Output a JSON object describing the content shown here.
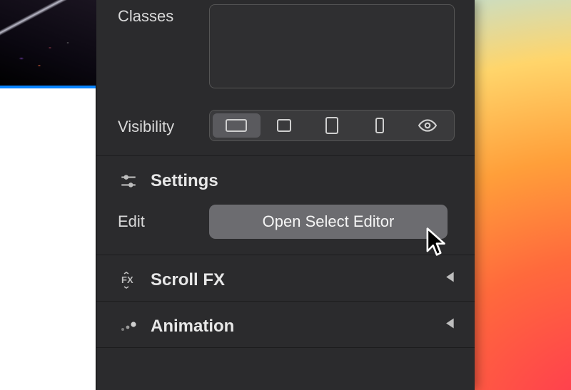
{
  "inspector": {
    "classes": {
      "label": "Classes",
      "value": ""
    },
    "visibility": {
      "label": "Visibility",
      "options": [
        "desktop",
        "laptop",
        "tablet",
        "phone",
        "preview"
      ],
      "active": "desktop"
    }
  },
  "settings": {
    "title": "Settings",
    "edit_label": "Edit",
    "open_editor_button": "Open Select Editor"
  },
  "panels": {
    "scroll_fx": {
      "title": "Scroll FX",
      "expanded": false
    },
    "animation": {
      "title": "Animation",
      "expanded": false
    },
    "custom_attributes": {
      "title_partial": "",
      "expanded": false
    }
  },
  "colors": {
    "panel_bg": "#2b2b2d",
    "button_bg": "#6c6c70",
    "accent": "#0a84ff"
  }
}
